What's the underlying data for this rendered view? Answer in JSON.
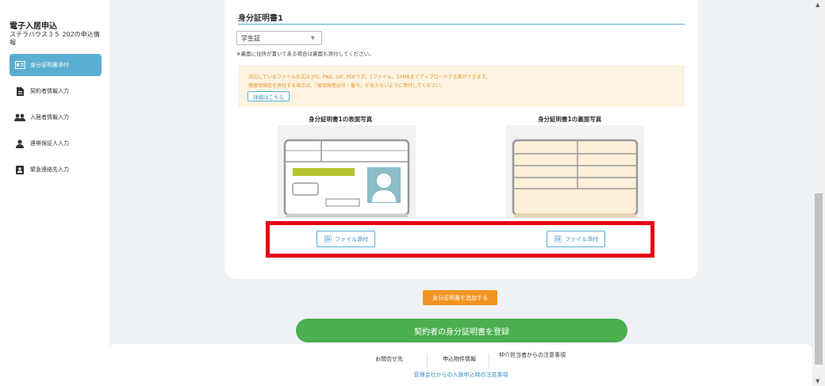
{
  "sidebar": {
    "title": "電子入居申込",
    "subtitle": "ステラハウス３５ 202の申込情報",
    "items": [
      {
        "label": "身分証明書添付",
        "icon": "id-card-icon",
        "active": true
      },
      {
        "label": "契約者情報入力",
        "icon": "document-icon",
        "active": false
      },
      {
        "label": "入居者情報入力",
        "icon": "users-icon",
        "active": false
      },
      {
        "label": "連帯保証人入力",
        "icon": "person-icon",
        "active": false
      },
      {
        "label": "緊急連絡先入力",
        "icon": "contact-book-icon",
        "active": false
      }
    ]
  },
  "section": {
    "title": "身分証明書1",
    "select_value": "学生証",
    "note": "※裏面に住所が書いてある場合は裏面も添付してください。",
    "info_line1": "対応しているファイル形式は JPG, PNG, GIF, PDFです。1ファイル、10MBまでアップロードする事ができます。",
    "info_line2": "健康保険証を添付する場合は、「被保険者記号・番号」が見えないように添付してください。",
    "info_button": "詳細はこちら",
    "front_label": "身分証明書1の表面写真",
    "back_label": "身分証明書1の裏面写真",
    "file_button": "ファイル添付"
  },
  "actions": {
    "add_label": "身分証明書を追加する",
    "register_label": "契約者の身分証明書を登録"
  },
  "footer": {
    "contact": "お問合せ先",
    "property": "申込物件情報",
    "agent_notes": "仲介担当者からの注意事項",
    "management_notes": "管理会社からの入居申込時の注意事項"
  },
  "colors": {
    "accent": "#5aaed1",
    "orange": "#f39422",
    "green": "#4caf50",
    "highlight": "#e60012"
  }
}
